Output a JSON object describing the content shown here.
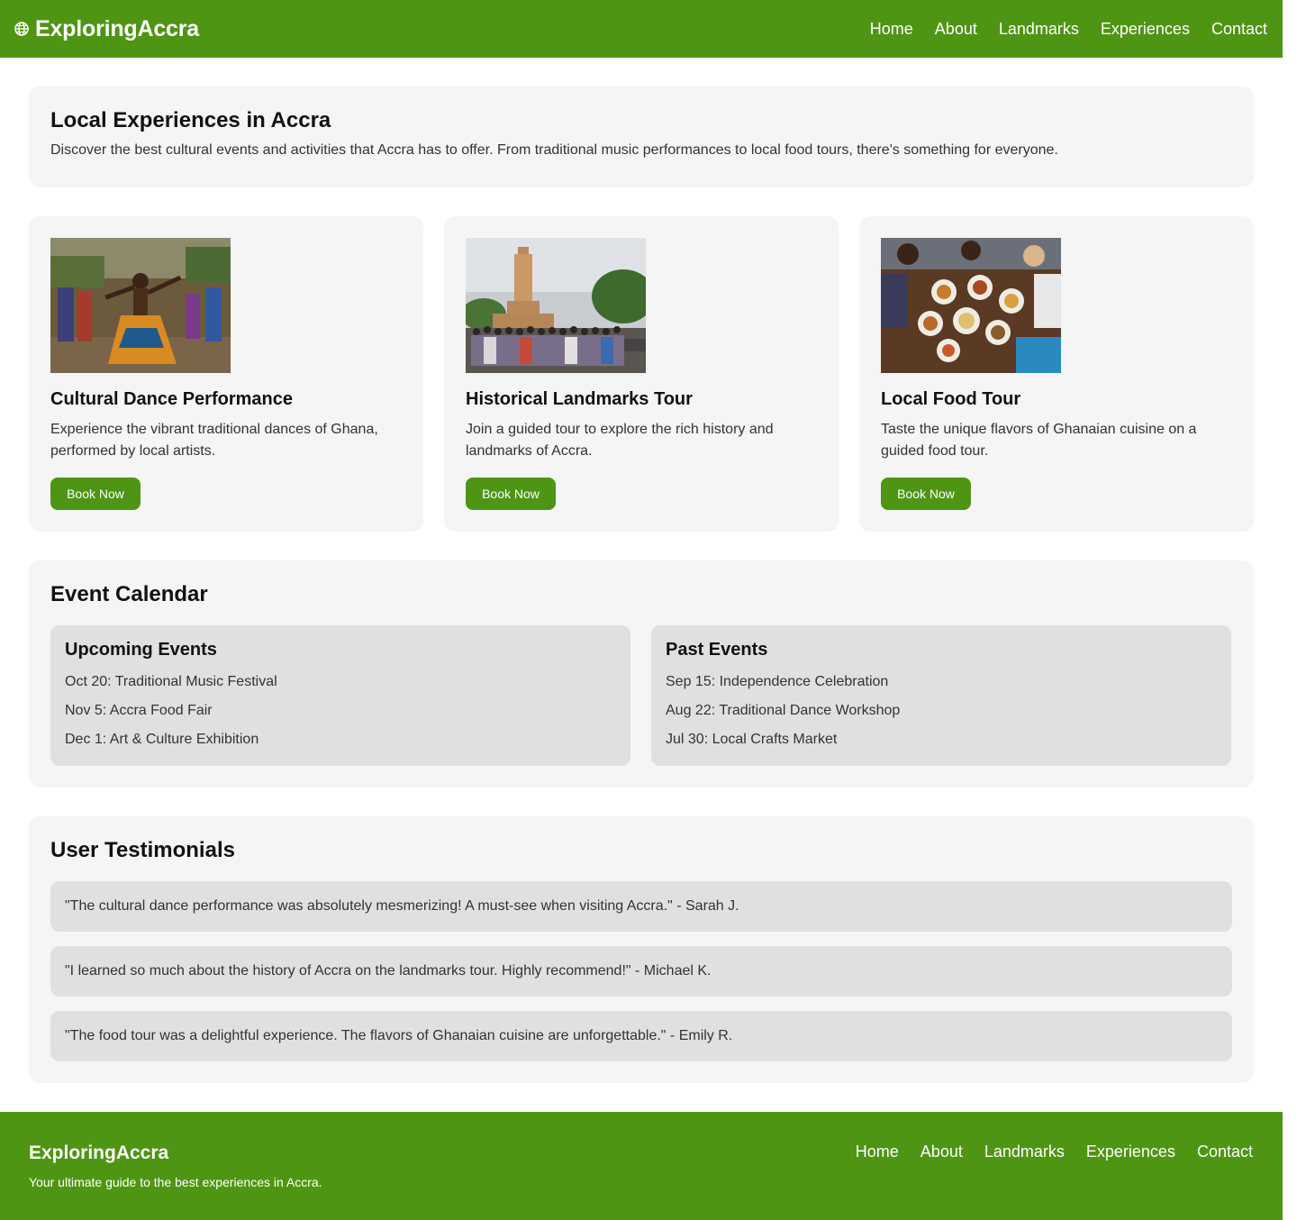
{
  "header": {
    "brand": "ExploringAccra",
    "nav": [
      "Home",
      "About",
      "Landmarks",
      "Experiences",
      "Contact"
    ]
  },
  "intro": {
    "title": "Local Experiences in Accra",
    "text": "Discover the best cultural events and activities that Accra has to offer. From traditional music performances to local food tours, there's something for everyone."
  },
  "cards": [
    {
      "title": "Cultural Dance Performance",
      "text": "Experience the vibrant traditional dances of Ghana, performed by local artists.",
      "button": "Book Now"
    },
    {
      "title": "Historical Landmarks Tour",
      "text": "Join a guided tour to explore the rich history and landmarks of Accra.",
      "button": "Book Now"
    },
    {
      "title": "Local Food Tour",
      "text": "Taste the unique flavors of Ghanaian cuisine on a guided food tour.",
      "button": "Book Now"
    }
  ],
  "calendar": {
    "title": "Event Calendar",
    "upcoming": {
      "title": "Upcoming Events",
      "items": [
        "Oct 20: Traditional Music Festival",
        "Nov 5: Accra Food Fair",
        "Dec 1: Art & Culture Exhibition"
      ]
    },
    "past": {
      "title": "Past Events",
      "items": [
        "Sep 15: Independence Celebration",
        "Aug 22: Traditional Dance Workshop",
        "Jul 30: Local Crafts Market"
      ]
    }
  },
  "testimonials": {
    "title": "User Testimonials",
    "items": [
      "\"The cultural dance performance was absolutely mesmerizing! A must-see when visiting Accra.\" - Sarah J.",
      "\"I learned so much about the history of Accra on the landmarks tour. Highly recommend!\" - Michael K.",
      "\"The food tour was a delightful experience. The flavors of Ghanaian cuisine are unforgettable.\" - Emily R."
    ]
  },
  "footer": {
    "brand": "ExploringAccra",
    "tagline": "Your ultimate guide to the best experiences in Accra.",
    "nav": [
      "Home",
      "About",
      "Landmarks",
      "Experiences",
      "Contact"
    ]
  },
  "colors": {
    "brand_green": "#4f9514",
    "panel": "#f5f5f5",
    "subpanel": "#e0e0e0"
  },
  "icons": {
    "brand_icon": "globe-icon"
  }
}
